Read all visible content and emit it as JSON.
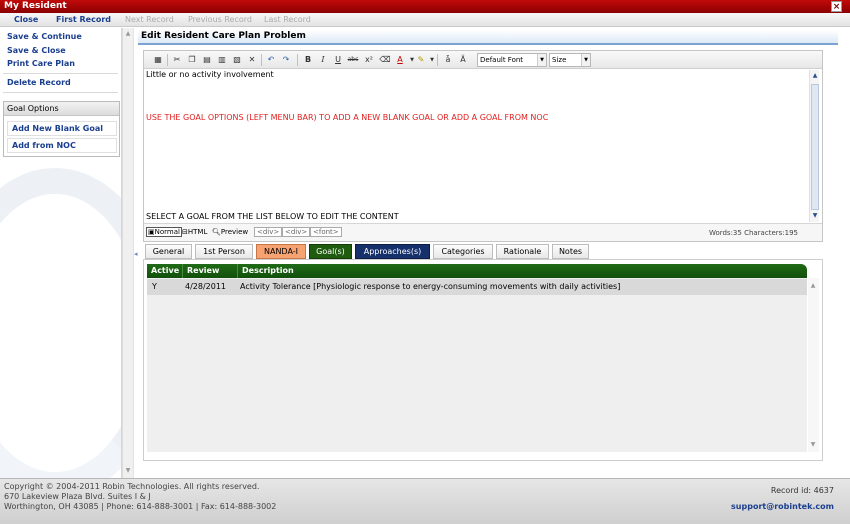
{
  "window": {
    "title": "My Resident",
    "close_glyph": "×"
  },
  "nav": {
    "close": "Close",
    "first": "First Record",
    "next": "Next Record",
    "previous": "Previous Record",
    "last": "Last Record"
  },
  "sidebar": {
    "save_continue": "Save & Continue",
    "save_close": "Save & Close",
    "print": "Print Care Plan",
    "delete": "Delete Record",
    "goal_options": {
      "title": "Goal Options",
      "add_blank": "Add New Blank Goal",
      "add_noc": "Add from NOC"
    }
  },
  "panel": {
    "title": "Edit Resident Care Plan Problem"
  },
  "editor": {
    "font_select": "Default Font",
    "size_select": "Size",
    "line1": "Little or no activity involvement",
    "line2": "USE THE GOAL OPTIONS (LEFT MENU BAR) TO ADD A NEW BLANK GOAL OR ADD A GOAL FROM NOC",
    "line3": "SELECT A GOAL FROM THE LIST BELOW TO EDIT THE CONTENT",
    "text_color": "#e02020",
    "modes": {
      "normal": "Normal",
      "html": "HTML",
      "preview": "Preview"
    },
    "tags": [
      "<div>",
      "<div>",
      "<font>"
    ],
    "counts": "Words:35 Characters:195"
  },
  "tabs": [
    {
      "label": "General"
    },
    {
      "label": "1st Person"
    },
    {
      "label": "NANDA-I"
    },
    {
      "label": "Goal(s)"
    },
    {
      "label": "Approaches(s)"
    },
    {
      "label": "Categories"
    },
    {
      "label": "Rationale"
    },
    {
      "label": "Notes"
    }
  ],
  "grid": {
    "headers": {
      "active": "Active",
      "review": "Review",
      "description": "Description"
    },
    "rows": [
      {
        "active": "Y",
        "review": "4/28/2011",
        "description": "Activity Tolerance [Physiologic response to energy-consuming movements with daily activities]"
      }
    ],
    "header_color": "#1f6b16"
  },
  "footer": {
    "copyright": "Copyright © 2004-2011 Robin Technologies. All rights reserved.",
    "address": "670 Lakeview Plaza Blvd. Suites I & J",
    "contact": "Worthington, OH 43085 | Phone: 614-888-3001 | Fax: 614-888-3002",
    "record_id": "Record id: 4637",
    "email": "support@robintek.com"
  },
  "icons": [
    "window-close-icon",
    "table-icon",
    "cut-icon",
    "copy-icon",
    "paste-icon",
    "paste-text-icon",
    "paste-word-icon",
    "delete-icon",
    "undo-icon",
    "redo-icon",
    "bold-icon",
    "italic-icon",
    "underline-icon",
    "strikethrough-icon",
    "superscript-icon",
    "eraser-icon",
    "font-color-icon",
    "highlight-icon",
    "find-icon",
    "replace-icon"
  ]
}
